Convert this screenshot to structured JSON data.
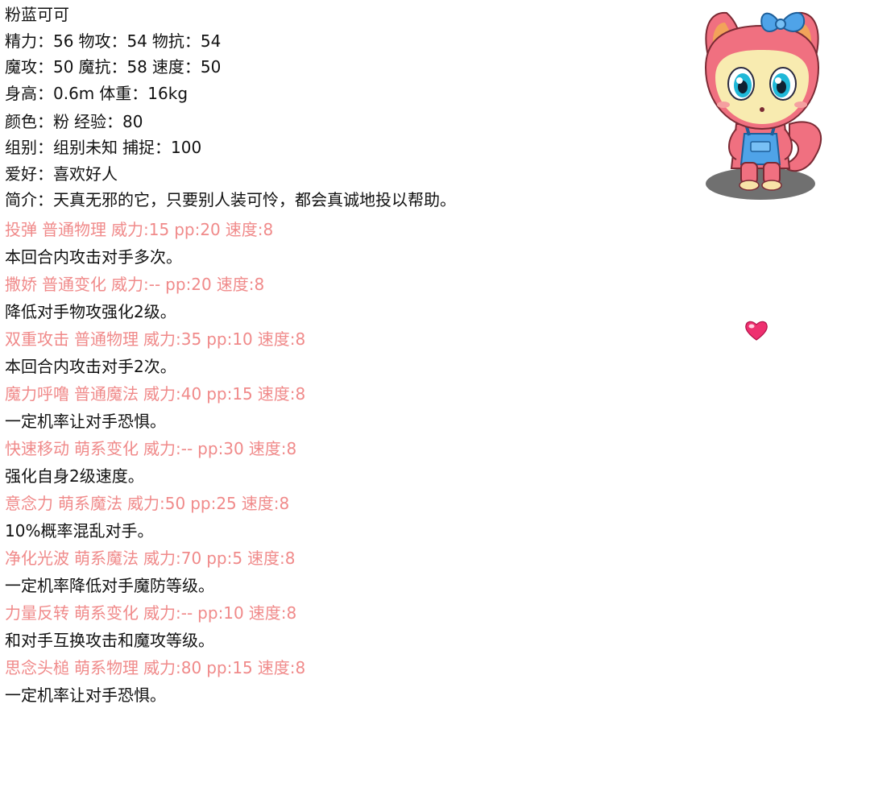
{
  "pet": {
    "name": "粉蓝可可",
    "stats": [
      [
        "精力：56",
        "物攻：54",
        "物抗：54"
      ],
      [
        "魔攻：50",
        "魔抗：58",
        "速度：50"
      ],
      [
        "身高：0.6m",
        "体重：16kg"
      ],
      [
        "颜色：粉",
        "经验：80"
      ],
      [
        "组别：组别未知",
        "捕捉：100"
      ]
    ],
    "hobby": "爱好：喜欢好人",
    "intro": "简介：天真无邪的它，只要别人装可怜，都会真诚地投以帮助。"
  },
  "skills": [
    {
      "name": "投弹",
      "type": "普通物理",
      "power": "威力:15",
      "pp": "pp:20",
      "speed": "速度:8",
      "desc": "本回合内攻击对手多次。"
    },
    {
      "name": "撒娇",
      "type": "普通变化",
      "power": "威力:--",
      "pp": "pp:20",
      "speed": "速度:8",
      "desc": "降低对手物攻强化2级。"
    },
    {
      "name": "双重攻击",
      "type": "普通物理",
      "power": "威力:35",
      "pp": "pp:10",
      "speed": "速度:8",
      "desc": "本回合内攻击对手2次。"
    },
    {
      "name": "魔力呼噜",
      "type": "普通魔法",
      "power": "威力:40",
      "pp": "pp:15",
      "speed": "速度:8",
      "desc": "一定机率让对手恐惧。"
    },
    {
      "name": "快速移动",
      "type": "萌系变化",
      "power": "威力:--",
      "pp": "pp:30",
      "speed": "速度:8",
      "desc": "强化自身2级速度。"
    },
    {
      "name": "意念力",
      "type": "萌系魔法",
      "power": "威力:50",
      "pp": "pp:25",
      "speed": "速度:8",
      "desc": "10%概率混乱对手。"
    },
    {
      "name": "净化光波",
      "type": "萌系魔法",
      "power": "威力:70",
      "pp": "pp:5",
      "speed": "速度:8",
      "desc": "一定机率降低对手魔防等级。"
    },
    {
      "name": "力量反转",
      "type": "萌系变化",
      "power": "威力:--",
      "pp": "pp:10",
      "speed": "速度:8",
      "desc": "和对手互换攻击和魔攻等级。"
    },
    {
      "name": "思念头槌",
      "type": "萌系物理",
      "power": "威力:80",
      "pp": "pp:15",
      "speed": "速度:8",
      "desc": "一定机率让对手恐惧。"
    }
  ],
  "colors": {
    "skill_header": "#f08a8a",
    "text": "#111111",
    "background": "#ffffff"
  },
  "icons": {
    "portrait": "pink-cat-pet-portrait-icon",
    "heart": "heart-icon"
  }
}
